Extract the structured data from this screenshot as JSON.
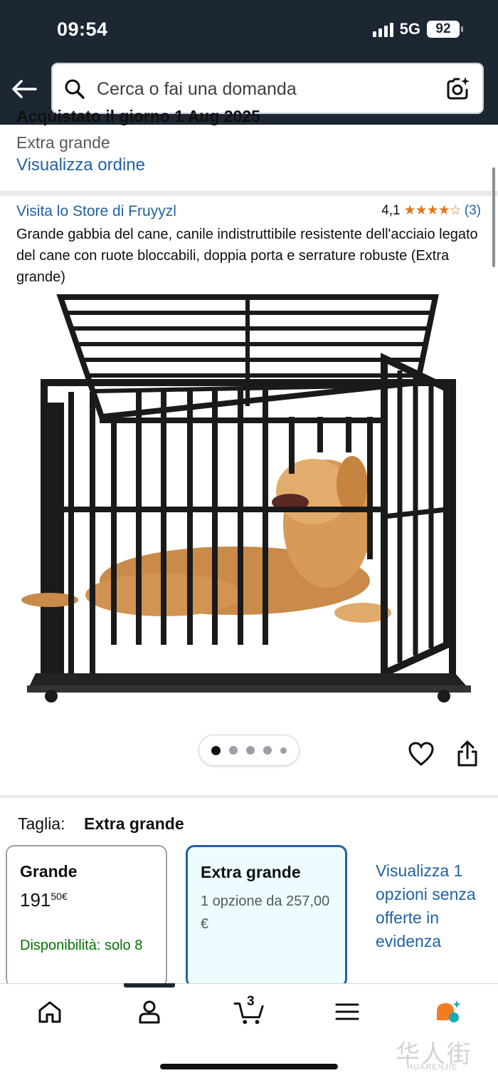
{
  "status_bar": {
    "time": "09:54",
    "network": "5G",
    "battery": "92"
  },
  "search": {
    "placeholder": "Cerca o fai una domanda"
  },
  "order": {
    "purchased_partial": "Acquistato il giorno 1 Aug 2025",
    "size": "Extra grande",
    "view_order": "Visualizza ordine"
  },
  "product": {
    "store_link": "Visita lo Store di Fruyyzl",
    "rating_value": "4,1",
    "rating_count": "(3)",
    "stars": 4.1,
    "title": "Grande gabbia del cane, canile indistruttibile resistente dell'acciaio legato del cane con ruote bloccabili, doppia porta e serrature robuste (Extra grande)",
    "image_count": 5,
    "image_index": 1
  },
  "size_selector": {
    "label": "Taglia:",
    "selected": "Extra grande",
    "options": [
      {
        "name": "Grande",
        "price_whole": "191",
        "price_fraction": "50",
        "currency": "€",
        "availability": "Disponibilità: solo 8"
      },
      {
        "name": "Extra grande",
        "option_text": "1 opzione da 257,00 €"
      }
    ],
    "view_more": "Visualizza 1 opzioni senza offerte in evidenza"
  },
  "bottom_nav": {
    "cart_count": "3"
  },
  "watermark": {
    "text": "华人街",
    "sub": "HUARENJIE"
  },
  "colors": {
    "header": "#1d2733",
    "link": "#2162a1",
    "star": "#de7921",
    "availability": "#007600",
    "selected_border": "#2162a1"
  }
}
